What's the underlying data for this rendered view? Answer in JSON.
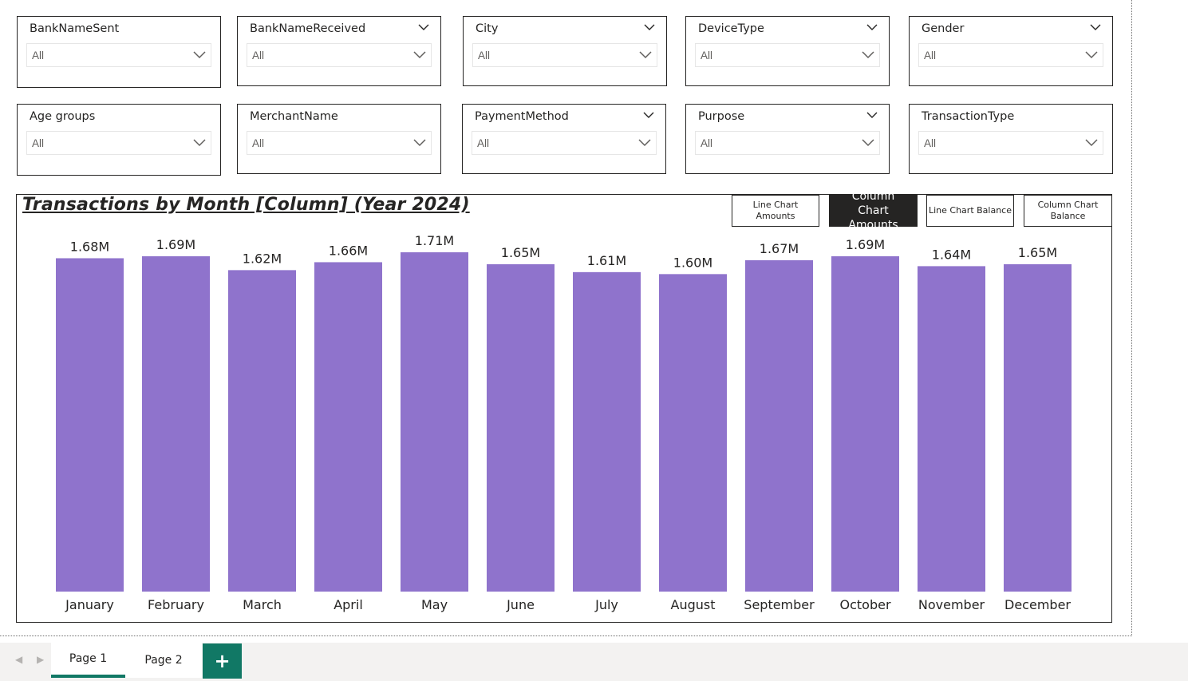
{
  "slicers": [
    {
      "title": "BankNameSent",
      "value": "All",
      "header_chevron": false
    },
    {
      "title": "BankNameReceived",
      "value": "All",
      "header_chevron": true
    },
    {
      "title": "City",
      "value": "All",
      "header_chevron": true
    },
    {
      "title": "DeviceType",
      "value": "All",
      "header_chevron": true
    },
    {
      "title": "Gender",
      "value": "All",
      "header_chevron": true
    },
    {
      "title": "Age groups",
      "value": "All",
      "header_chevron": false
    },
    {
      "title": "MerchantName",
      "value": "All",
      "header_chevron": false
    },
    {
      "title": "PaymentMethod",
      "value": "All",
      "header_chevron": true
    },
    {
      "title": "Purpose",
      "value": "All",
      "header_chevron": true
    },
    {
      "title": "TransactionType",
      "value": "All",
      "header_chevron": false
    }
  ],
  "toggles": [
    {
      "label": "Line Chart Amounts",
      "active": false
    },
    {
      "label": "Column Chart Amounts",
      "active": true
    },
    {
      "label": "Line Chart Balance",
      "active": false
    },
    {
      "label": "Column Chart Balance",
      "active": false
    }
  ],
  "chart_data": {
    "type": "bar",
    "title": "Transactions by Month [Column] (Year 2024)",
    "categories": [
      "January",
      "February",
      "March",
      "April",
      "May",
      "June",
      "July",
      "August",
      "September",
      "October",
      "November",
      "December"
    ],
    "values": [
      1.68,
      1.69,
      1.62,
      1.66,
      1.71,
      1.65,
      1.61,
      1.6,
      1.67,
      1.69,
      1.64,
      1.65
    ],
    "data_labels": [
      "1.68M",
      "1.69M",
      "1.62M",
      "1.66M",
      "1.71M",
      "1.65M",
      "1.61M",
      "1.60M",
      "1.67M",
      "1.69M",
      "1.64M",
      "1.65M"
    ],
    "unit": "M",
    "bar_color": "#8f73cc",
    "ylim": [
      0,
      1.71
    ],
    "grid": false,
    "xlabel": "",
    "ylabel": ""
  },
  "pages": {
    "tabs": [
      {
        "label": "Page 1",
        "active": true
      },
      {
        "label": "Page 2",
        "active": false
      }
    ],
    "add_label": "+",
    "prev_icon": "chevron-left-icon",
    "next_icon": "chevron-right-icon"
  }
}
